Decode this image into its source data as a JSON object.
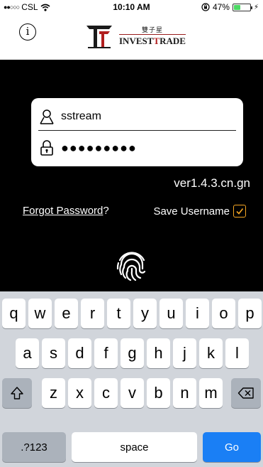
{
  "status_bar": {
    "signal_icon": "signal-dots-icon",
    "carrier": "CSL",
    "wifi_icon": "wifi-icon",
    "time": "10:10 AM",
    "lock_icon": "rotation-lock-icon",
    "battery_percent": "47%",
    "battery_level": 0.47,
    "charging_icon": "charging-bolt-icon"
  },
  "header": {
    "info_icon": "info-icon",
    "logo_chinese": "雙子星",
    "logo_brand_part1": "INVEST",
    "logo_brand_part2": "RADE",
    "logo_brand_letter": "T",
    "accent_color": "#b11e1e"
  },
  "login": {
    "username": "sstream",
    "password_masked": "●●●●●●●●●",
    "version": "ver1.4.3.cn.gn",
    "forgot_label": "Forgot Password",
    "forgot_suffix": "?",
    "save_username_label": "Save Username",
    "save_username_checked": true,
    "checkbox_color": "#f5a623"
  },
  "keyboard": {
    "row1": [
      "q",
      "w",
      "e",
      "r",
      "t",
      "y",
      "u",
      "i",
      "o",
      "p"
    ],
    "row2": [
      "a",
      "s",
      "d",
      "f",
      "g",
      "h",
      "j",
      "k",
      "l"
    ],
    "row3": [
      "z",
      "x",
      "c",
      "v",
      "b",
      "n",
      "m"
    ],
    "numbers_label": ".?123",
    "space_label": "space",
    "go_label": "Go",
    "go_color": "#1a7ff5"
  }
}
